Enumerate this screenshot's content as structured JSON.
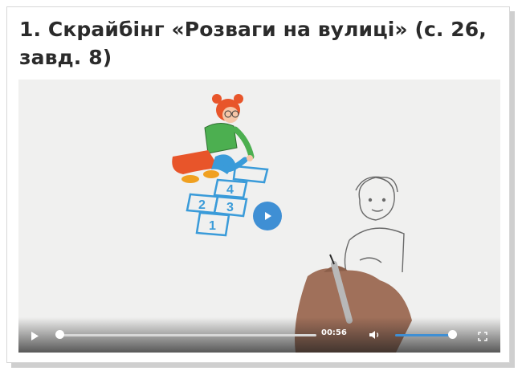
{
  "title": "1. Скрайбінг «Розваги на вулиці» (с. 26, завд. 8)",
  "video": {
    "current_time": "00:56",
    "progress": 0.0,
    "volume": 1.0,
    "accent_color": "#3f8fd4",
    "hopscotch_numbers": [
      "4",
      "2",
      "3",
      "1"
    ]
  },
  "icons": {
    "play": "play-icon",
    "volume": "volume-icon",
    "fullscreen": "fullscreen-icon"
  }
}
